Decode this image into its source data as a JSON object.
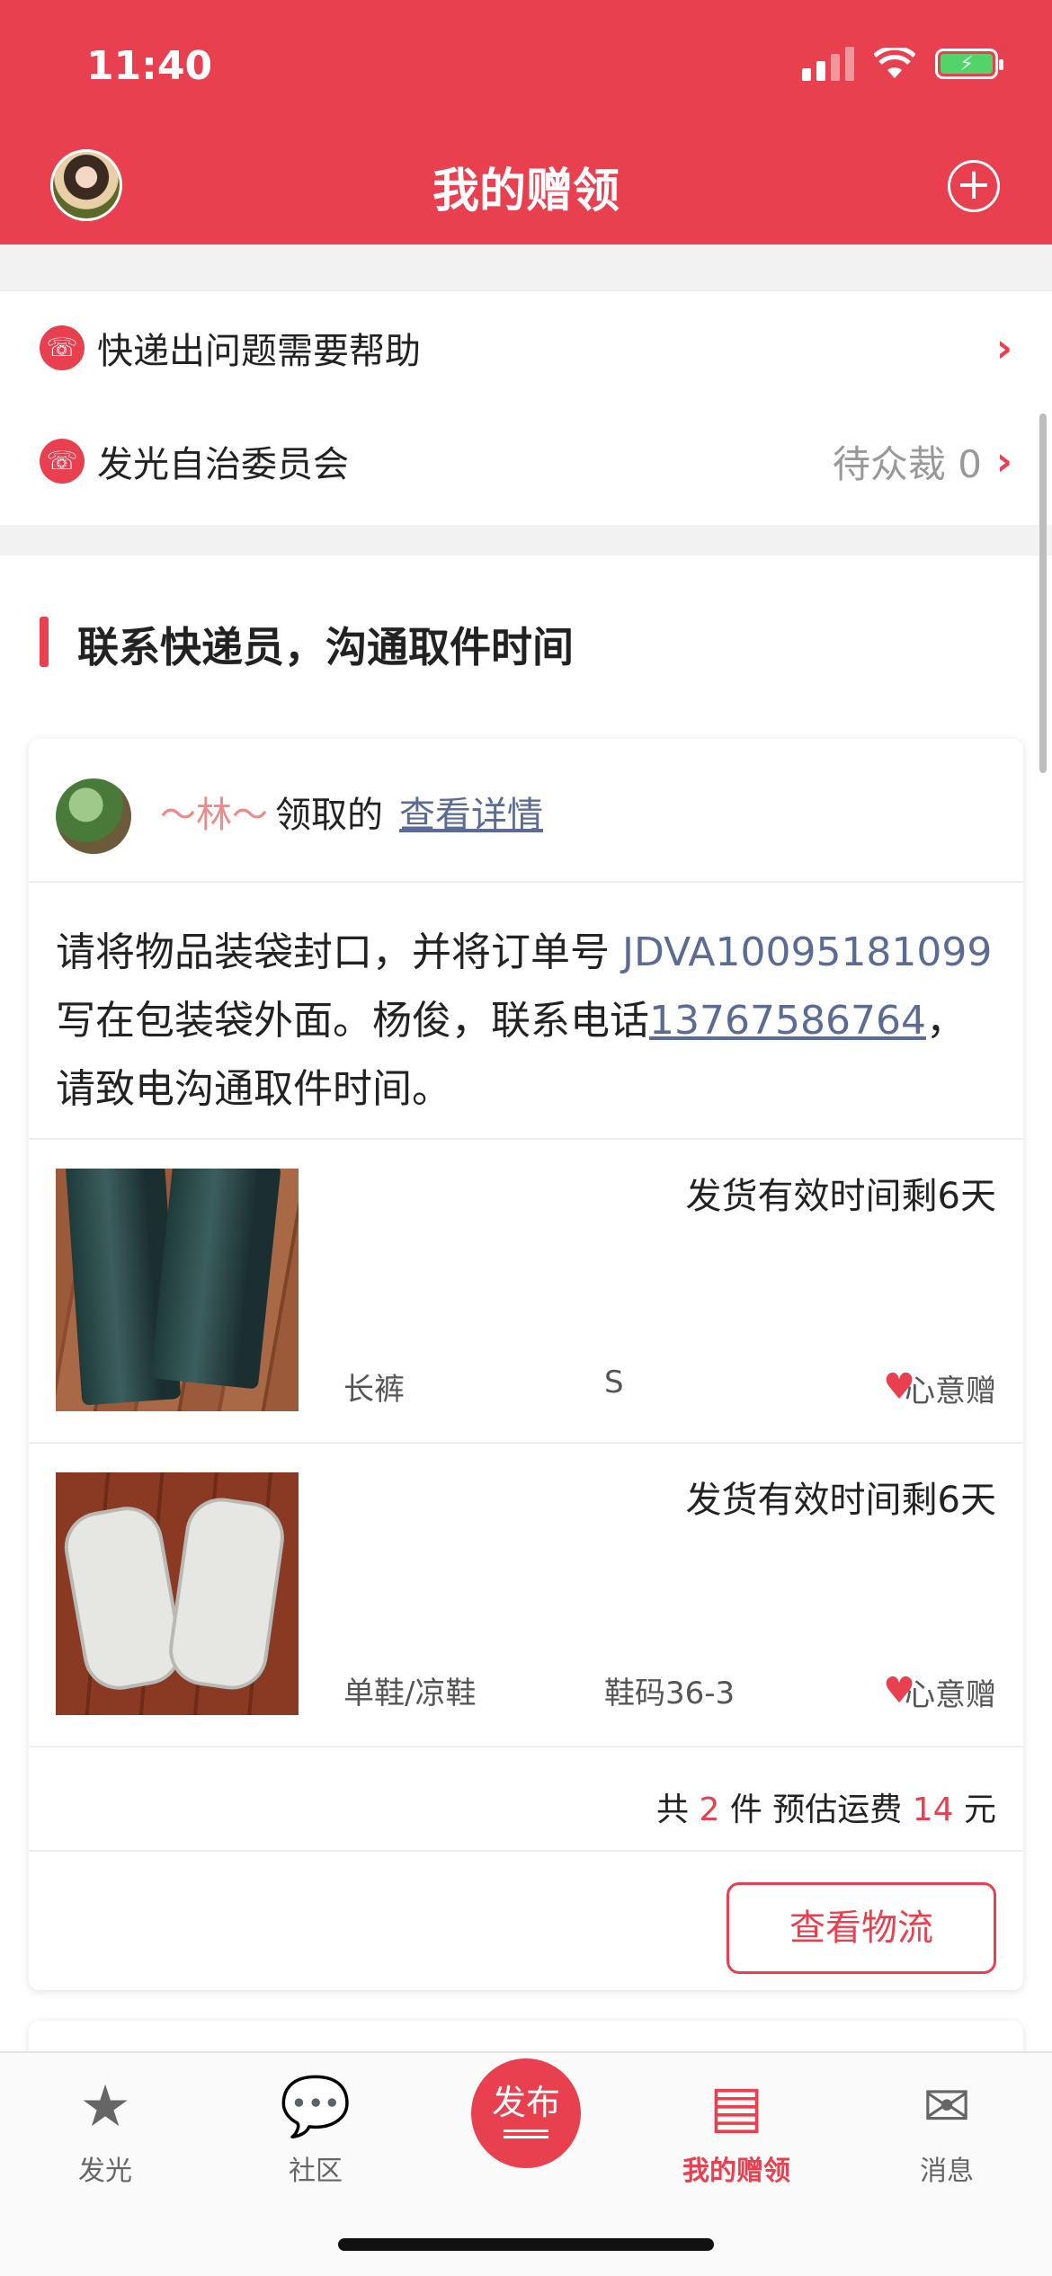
{
  "status": {
    "time": "11:40"
  },
  "header": {
    "title": "我的赠领",
    "add_icon": "plus-circle-icon"
  },
  "help": {
    "items": [
      {
        "label": "快递出问题需要帮助",
        "right": ""
      },
      {
        "label": "发光自治委员会",
        "right": "待众裁 0"
      }
    ]
  },
  "section": {
    "title": "联系快递员，沟通取件时间"
  },
  "card": {
    "giver_name": "～林～",
    "action": "领取的",
    "detail_link": "查看详情",
    "message": {
      "before_order": "请将物品装袋封口，并将订单号 ",
      "order_number": "JDVA10095181099",
      "middle": " 写在包装袋外面。杨俊，联系电话",
      "phone": "13767586764",
      "after": "，请致电沟通取件时间。"
    },
    "items": [
      {
        "validity": "发货有效时间剩6天",
        "name": "长裤",
        "size": "S",
        "tag": "心意赠",
        "image": "leather-pants-photo"
      },
      {
        "validity": "发货有效时间剩6天",
        "name": "单鞋/凉鞋",
        "size": "鞋码36-3",
        "tag": "心意赠",
        "image": "white-sneakers-photo"
      }
    ],
    "total": {
      "prefix": "共",
      "count": "2",
      "mid": "件 预估运费",
      "fee": "14",
      "unit": "元"
    },
    "logistics_button": "查看物流"
  },
  "tabbar": {
    "tabs": [
      {
        "label": "发光",
        "icon": "star-icon"
      },
      {
        "label": "社区",
        "icon": "chat-bubble-icon"
      },
      {
        "label": "发布",
        "icon": "publish-icon"
      },
      {
        "label": "我的赠领",
        "icon": "gift-cards-icon",
        "active": true
      },
      {
        "label": "消息",
        "icon": "envelope-icon"
      }
    ]
  },
  "colors": {
    "brand": "#e8404f",
    "link": "#5a6b96"
  }
}
